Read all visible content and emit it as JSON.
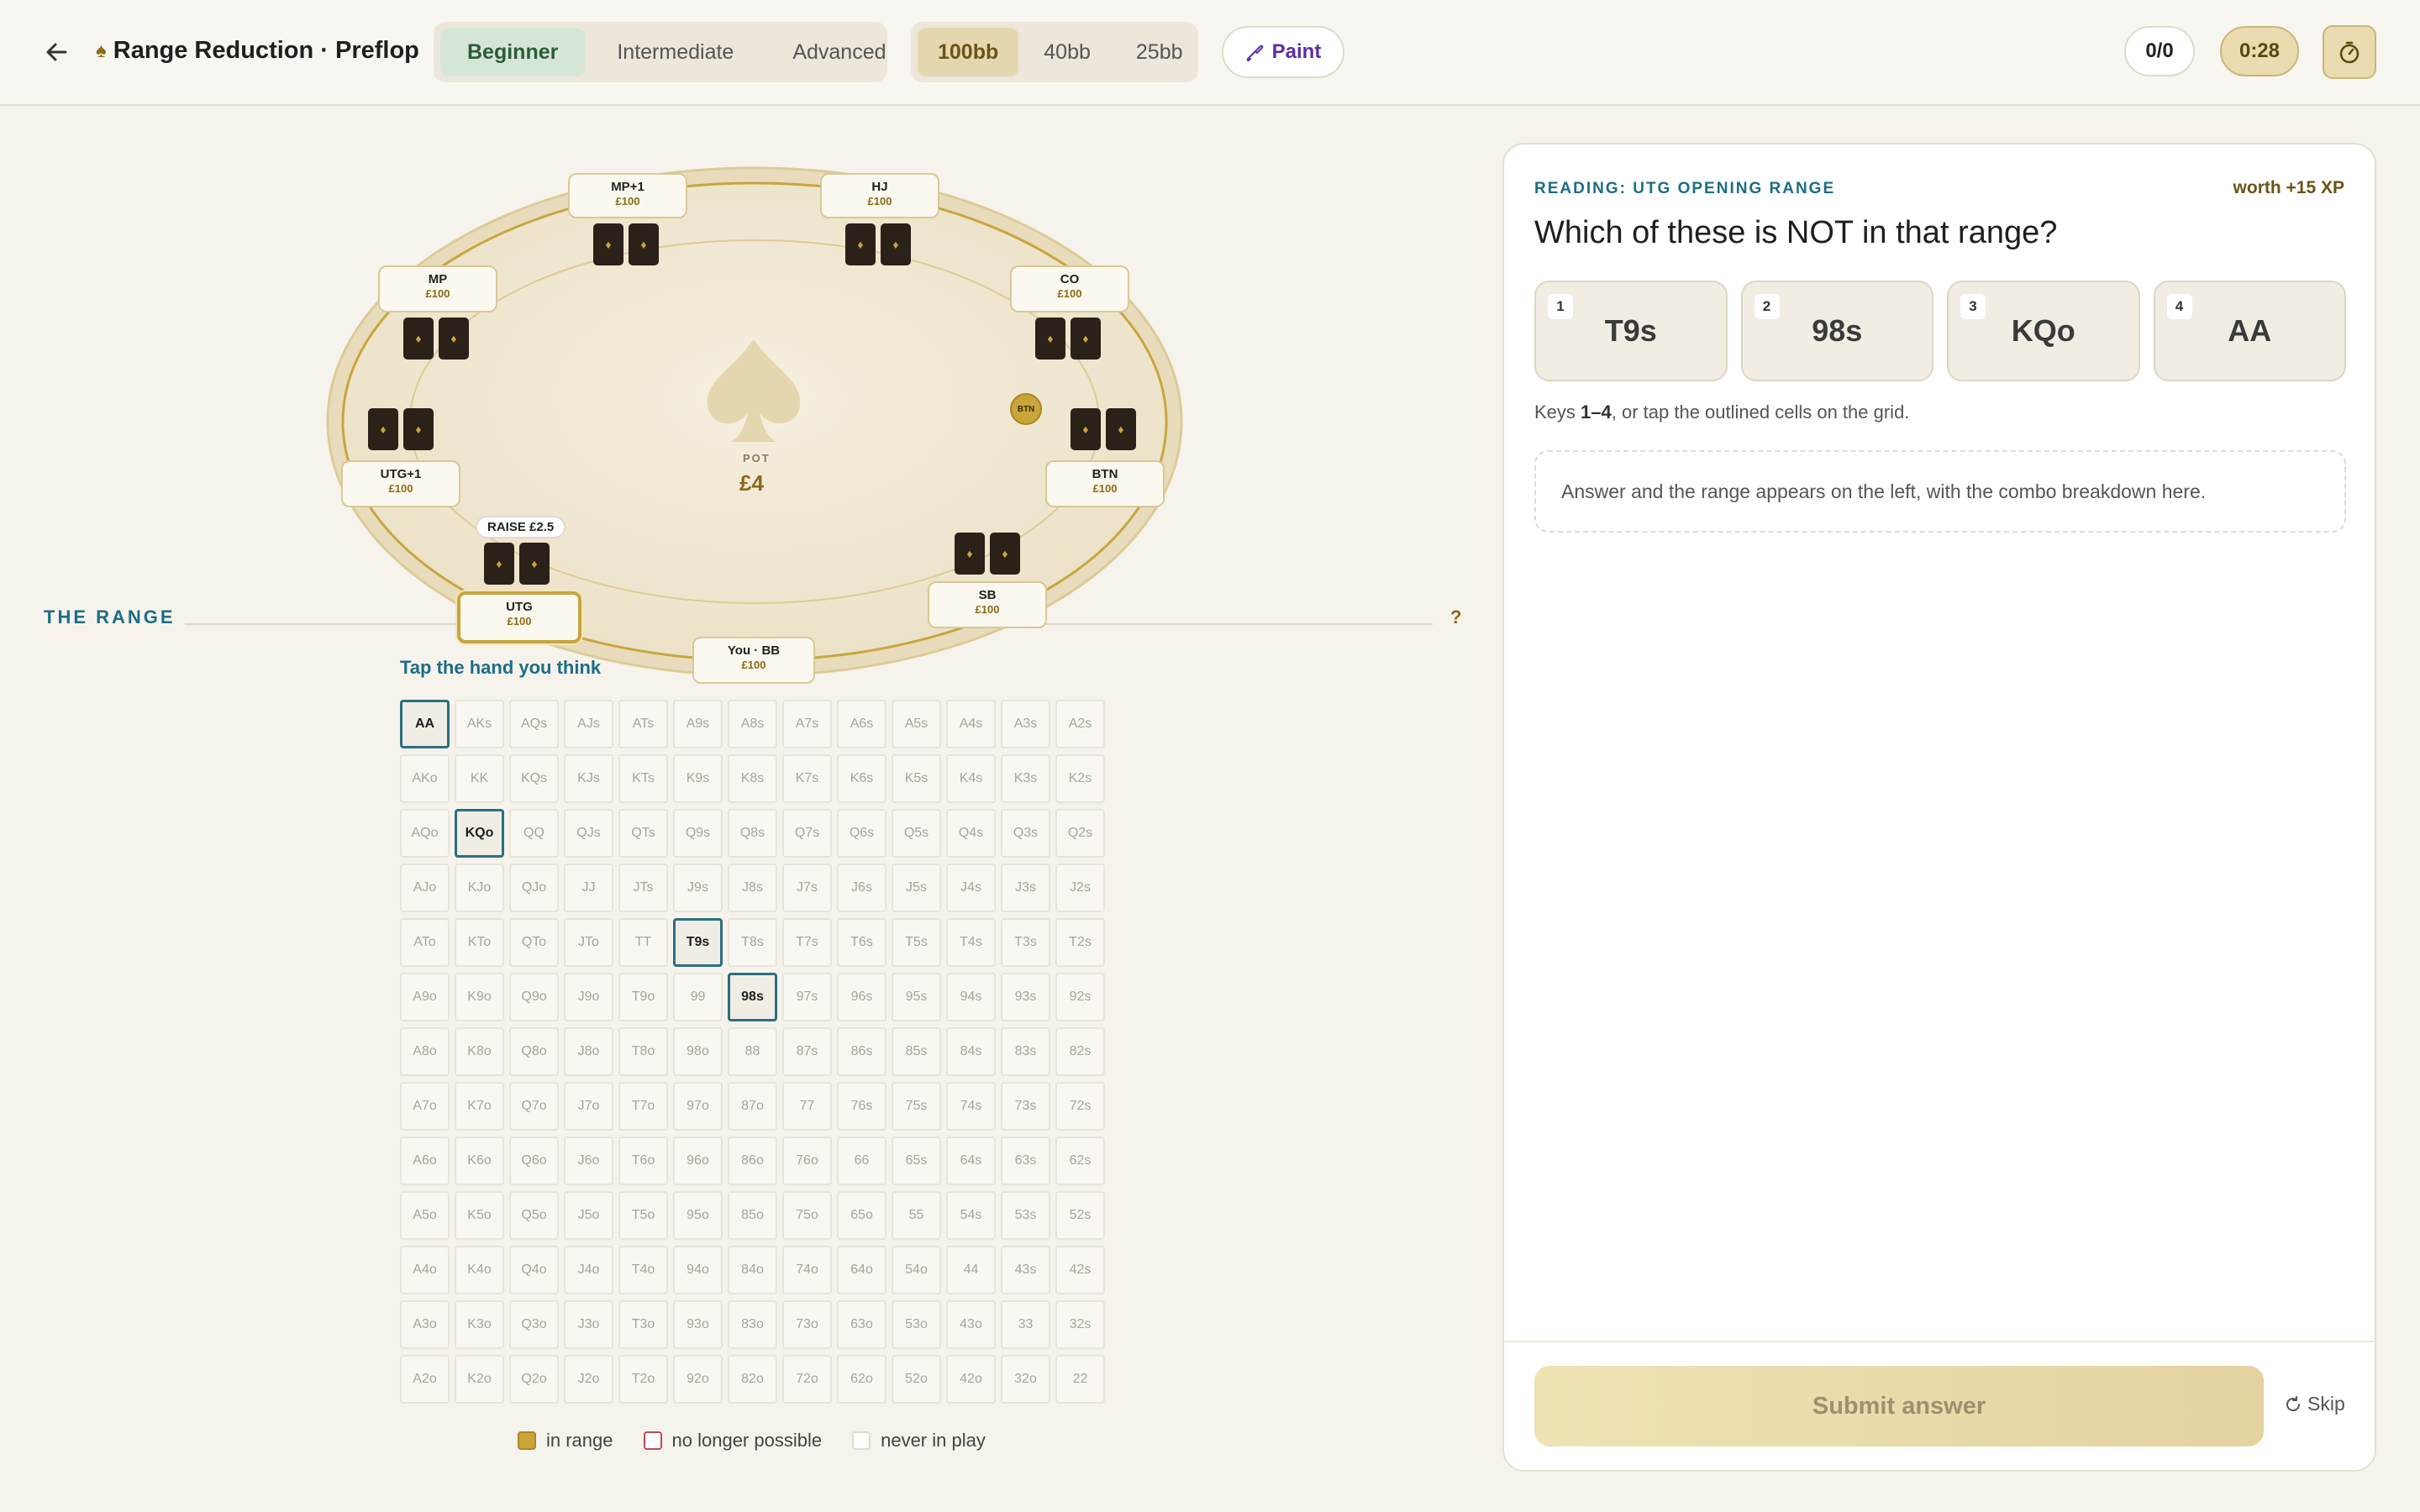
{
  "header": {
    "title": "Range Reduction · Preflop",
    "levels": [
      "Beginner",
      "Intermediate",
      "Advanced"
    ],
    "active_level": "Beginner",
    "stacks": [
      "100bb",
      "40bb",
      "25bb"
    ],
    "active_stack": "100bb",
    "paint_label": "Paint",
    "score": "0/0",
    "time": "0:28"
  },
  "table": {
    "pot_label": "POT",
    "pot_value": "£4",
    "raise_tag": "RAISE £2.5",
    "dealer_chip": "BTN",
    "seats": [
      {
        "name": "MP+1",
        "stack": "£100"
      },
      {
        "name": "HJ",
        "stack": "£100"
      },
      {
        "name": "MP",
        "stack": "£100"
      },
      {
        "name": "CO",
        "stack": "£100"
      },
      {
        "name": "UTG+1",
        "stack": "£100"
      },
      {
        "name": "BTN",
        "stack": "£100"
      },
      {
        "name": "UTG",
        "stack": "£100"
      },
      {
        "name": "SB",
        "stack": "£100"
      },
      {
        "name": "You · BB",
        "stack": "£100"
      }
    ]
  },
  "range": {
    "heading": "THE RANGE",
    "help": "?",
    "prompt": "Tap the hand you think",
    "outlined": [
      "AA",
      "KQo",
      "T9s",
      "98s"
    ],
    "grid": [
      [
        "AA",
        "AKs",
        "AQs",
        "AJs",
        "ATs",
        "A9s",
        "A8s",
        "A7s",
        "A6s",
        "A5s",
        "A4s",
        "A3s",
        "A2s"
      ],
      [
        "AKo",
        "KK",
        "KQs",
        "KJs",
        "KTs",
        "K9s",
        "K8s",
        "K7s",
        "K6s",
        "K5s",
        "K4s",
        "K3s",
        "K2s"
      ],
      [
        "AQo",
        "KQo",
        "QQ",
        "QJs",
        "QTs",
        "Q9s",
        "Q8s",
        "Q7s",
        "Q6s",
        "Q5s",
        "Q4s",
        "Q3s",
        "Q2s"
      ],
      [
        "AJo",
        "KJo",
        "QJo",
        "JJ",
        "JTs",
        "J9s",
        "J8s",
        "J7s",
        "J6s",
        "J5s",
        "J4s",
        "J3s",
        "J2s"
      ],
      [
        "ATo",
        "KTo",
        "QTo",
        "JTo",
        "TT",
        "T9s",
        "T8s",
        "T7s",
        "T6s",
        "T5s",
        "T4s",
        "T3s",
        "T2s"
      ],
      [
        "A9o",
        "K9o",
        "Q9o",
        "J9o",
        "T9o",
        "99",
        "98s",
        "97s",
        "96s",
        "95s",
        "94s",
        "93s",
        "92s"
      ],
      [
        "A8o",
        "K8o",
        "Q8o",
        "J8o",
        "T8o",
        "98o",
        "88",
        "87s",
        "86s",
        "85s",
        "84s",
        "83s",
        "82s"
      ],
      [
        "A7o",
        "K7o",
        "Q7o",
        "J7o",
        "T7o",
        "97o",
        "87o",
        "77",
        "76s",
        "75s",
        "74s",
        "73s",
        "72s"
      ],
      [
        "A6o",
        "K6o",
        "Q6o",
        "J6o",
        "T6o",
        "96o",
        "86o",
        "76o",
        "66",
        "65s",
        "64s",
        "63s",
        "62s"
      ],
      [
        "A5o",
        "K5o",
        "Q5o",
        "J5o",
        "T5o",
        "95o",
        "85o",
        "75o",
        "65o",
        "55",
        "54s",
        "53s",
        "52s"
      ],
      [
        "A4o",
        "K4o",
        "Q4o",
        "J4o",
        "T4o",
        "94o",
        "84o",
        "74o",
        "64o",
        "54o",
        "44",
        "43s",
        "42s"
      ],
      [
        "A3o",
        "K3o",
        "Q3o",
        "J3o",
        "T3o",
        "93o",
        "83o",
        "73o",
        "63o",
        "53o",
        "43o",
        "33",
        "32s"
      ],
      [
        "A2o",
        "K2o",
        "Q2o",
        "J2o",
        "T2o",
        "92o",
        "82o",
        "72o",
        "62o",
        "52o",
        "42o",
        "32o",
        "22"
      ]
    ],
    "legend": [
      {
        "label": "in range",
        "color": "#c9a53a"
      },
      {
        "label": "no longer possible",
        "color": "#c0485a"
      },
      {
        "label": "never in play",
        "color": "#ffffff"
      }
    ]
  },
  "question": {
    "kicker": "READING: UTG OPENING RANGE",
    "xp": "worth +15 XP",
    "title": "Which of these is NOT in that range?",
    "options": [
      {
        "key": "1",
        "label": "T9s"
      },
      {
        "key": "2",
        "label": "98s"
      },
      {
        "key": "3",
        "label": "KQo"
      },
      {
        "key": "4",
        "label": "AA"
      }
    ],
    "hint_prefix": "Keys ",
    "hint_keys": "1–4",
    "hint_suffix": ", or tap the outlined cells on the grid.",
    "answer_placeholder": "Answer and the range appears on the left, with the combo breakdown here.",
    "submit_label": "Submit answer",
    "skip_label": "Skip"
  }
}
